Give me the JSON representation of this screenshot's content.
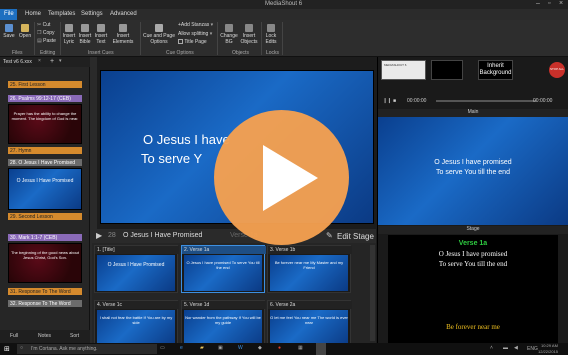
{
  "app": {
    "title": "MediaShout 6"
  },
  "menu": [
    "File",
    "Home",
    "Templates",
    "Settings",
    "Advanced"
  ],
  "ribbon": {
    "buttons": {
      "save": "Save",
      "open": "Open",
      "cut": "Cut",
      "copy": "Copy",
      "paste": "Paste",
      "insert_lyric": "Insert Lyric",
      "insert_bible": "Insert Bible",
      "insert_text": "Insert Text",
      "insert_elements": "Insert Elements",
      "cue_page_options": "Cue and Page Options",
      "add_stanzas": "+Add Stanzas",
      "allow_splitting": "Allow splitting",
      "title_page": "Title Page",
      "change_bg": "Change BG",
      "insert_objects": "Insert Objects",
      "lock_edits": "Lock Edits"
    },
    "groups": [
      "Files",
      "Editing",
      "Insert Cues",
      "Cue Options",
      "Objects",
      "Locks"
    ]
  },
  "left": {
    "tab_title": "Test v6 6.xxx",
    "items": [
      {
        "type": "section",
        "label": "25. First Lesson",
        "color": "#d58a2d"
      },
      {
        "type": "item",
        "label": "26. Psalms 99:12-17 (CEB)",
        "color": "#8a6ab8"
      },
      {
        "type": "thumb",
        "style": "red",
        "text": "Prayer has the ability to change the moment. The kingdom of God is near."
      },
      {
        "type": "section",
        "label": "27. Hymn",
        "color": "#d58a2d"
      },
      {
        "type": "item",
        "label": "28. O Jesus I Have Promised",
        "color": "#6c6c6c"
      },
      {
        "type": "thumb",
        "style": "blue",
        "text": "O Jesus I Have Promised"
      },
      {
        "type": "section",
        "label": "29. Second Lesson",
        "color": "#d58a2d"
      },
      {
        "type": "item",
        "label": "30. Mark 1:1-7 (CEB)",
        "color": "#8a6ab8"
      },
      {
        "type": "thumb",
        "style": "red",
        "text": "The beginning of the good news about Jesus Christ, God's Son."
      },
      {
        "type": "section",
        "label": "31. Response To The Word",
        "color": "#d58a2d"
      },
      {
        "type": "item",
        "label": "32. Response To The Word",
        "color": "#6c6c6c"
      }
    ],
    "bottom_tabs": [
      "Full",
      "Notes",
      "Sort"
    ]
  },
  "preview": {
    "line1": "O Jesus I have",
    "line2": "To serve Y"
  },
  "centerbar": {
    "index": "28",
    "title": "O Jesus I Have Promised",
    "verse": "Verse 1a",
    "edit_stage": "Edit Stage"
  },
  "slides": [
    {
      "header": "1. [Title]",
      "body": "O Jesus I Have Promised",
      "selected": false
    },
    {
      "header": "2. Verse 1a",
      "body": "O Jesus I have promised To serve You till the end",
      "selected": true
    },
    {
      "header": "3. Verse 1b",
      "body": "Be forever near me My Master and my Friend",
      "selected": false
    },
    {
      "header": "4. Verse 1c",
      "body": "I shall not fear the battle If You are by my side",
      "selected": false
    },
    {
      "header": "5. Verse 1d",
      "body": "Nor wander from the pathway If You will be my guide",
      "selected": false
    },
    {
      "header": "6. Verse 2a",
      "body": "O let me feel You near me The world is ever near",
      "selected": false
    }
  ],
  "right": {
    "buttons": {
      "inherit_background": "Inherit Background",
      "stop_all": "STOP ALL"
    },
    "time_left": "00:00:00",
    "time_right": "00:00:00",
    "main_label": "Main",
    "main_line1": "O Jesus I have promised",
    "main_line2": "To serve You till the end",
    "stage_label": "Stage",
    "stage_verse": "Verse 1a",
    "stage_line1": "O Jesus I have promised",
    "stage_line2": "To serve You till the end",
    "stage_next": "Be forever near me"
  },
  "taskbar": {
    "search": "I'm Cortana. Ask me anything.",
    "clock_time": "10:29 AM",
    "clock_date": "12/22/2015",
    "lang": "ENG"
  }
}
